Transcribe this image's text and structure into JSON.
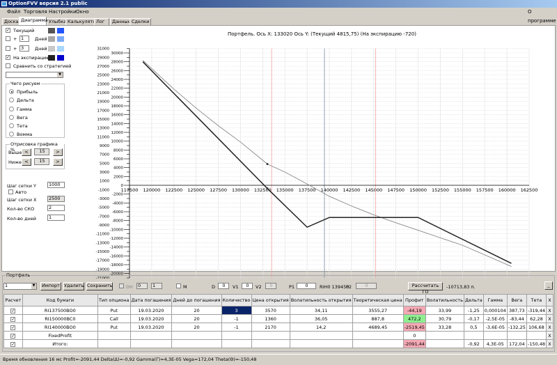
{
  "window": {
    "title": "OptionFVV версия 2.1 public"
  },
  "menu": [
    "Файл",
    "Торговля",
    "Настройки",
    "Окно"
  ],
  "menu_right": "О программе",
  "tabs": [
    "Доска",
    "Диаграмма",
    "Улыбка",
    "Калькулятор",
    "Лог",
    "Данные",
    "Сделки"
  ],
  "active_tab": "Диаграмма",
  "left": {
    "current": {
      "label": "Текущий",
      "checked": true,
      "colors": [
        "#555555",
        "#2255ff"
      ]
    },
    "plus1": {
      "prefix": "+",
      "value": "1",
      "unit": "Дней",
      "checked": false,
      "colors": [
        "#a8a8a8",
        "#7aaaf8"
      ]
    },
    "plus3": {
      "prefix": "+",
      "value": "3",
      "unit": "Дней",
      "checked": false,
      "colors": [
        "#c8c8c8",
        "#a8d8ff"
      ]
    },
    "expiry": {
      "label": "На экспирацию",
      "checked": true,
      "colors": [
        "#222222",
        "#0000cc"
      ]
    },
    "compare": {
      "label": "Сравнить со стратегией",
      "checked": false
    },
    "draw_group": {
      "title": "Чего рисуем",
      "options": [
        "Прибыль",
        "Дельта",
        "Гамма",
        "Вега",
        "Тета",
        "Вомма"
      ],
      "selected": "Прибыль"
    },
    "render_group": {
      "title": "Отрисовка графика %",
      "above_label": "Выше",
      "above_value": "15",
      "below_label": "Ниже",
      "below_value": "15",
      "dec": "<",
      "inc": ">"
    },
    "grid_y_label": "Шаг сетки Y",
    "grid_y": "1000",
    "auto_label": "Авто",
    "auto": false,
    "grid_x_label": "Шаг сетки X",
    "grid_x": "2500",
    "sko_label": "Кол-во СКО",
    "sko": "2",
    "days_label": "Кол-во дней",
    "days": "1"
  },
  "chart_title": "Портфель. Ось X:  133020 Ось Y:   (Текущий 4815,75)   (На экспирацию -720)",
  "chart_data": {
    "type": "line",
    "title": "Портфель. Ось X:  133020 Ось Y:   (Текущий 4815,75)   (На экспирацию -720)",
    "xlim": [
      117500,
      162500
    ],
    "ylim": [
      -21000,
      31000
    ],
    "x_ticks": [
      117500,
      120000,
      122500,
      125000,
      127500,
      130000,
      132500,
      135000,
      137500,
      140000,
      142500,
      145000,
      147500,
      150000,
      152500,
      155000,
      157500,
      160000,
      162500
    ],
    "y_ticks_inner": [
      30000,
      28000,
      26000,
      24000,
      22000,
      20000,
      18000,
      16000,
      14000,
      12000,
      10000,
      8000,
      6000,
      4000,
      2000,
      0,
      -2000,
      -4000,
      -6000,
      -8000,
      -10000,
      -12000,
      -14000,
      -16000,
      -18000,
      -20000
    ],
    "y_ticks_outer": [
      31000,
      29000,
      27000,
      25000,
      23000,
      21000,
      19000,
      17000,
      15000,
      13000,
      11000,
      9000,
      7000,
      5000,
      3000,
      1000,
      -1000,
      -3000,
      -5000,
      -7000,
      -9000,
      -11000,
      -13000,
      -15000,
      -17000,
      -19000,
      -21000
    ],
    "grid": true,
    "series": [
      {
        "name": "Текущий",
        "color": "#888888",
        "points": [
          [
            119000,
            28300
          ],
          [
            122500,
            21800
          ],
          [
            125000,
            17500
          ],
          [
            127500,
            13500
          ],
          [
            130000,
            9800
          ],
          [
            133020,
            4816
          ],
          [
            135000,
            3000
          ],
          [
            137500,
            300
          ],
          [
            140000,
            -2500
          ],
          [
            142500,
            -4700
          ],
          [
            145000,
            -6700
          ],
          [
            147500,
            -8500
          ],
          [
            150000,
            -10200
          ],
          [
            155000,
            -13600
          ],
          [
            160500,
            -18400
          ]
        ]
      },
      {
        "name": "На экспирацию",
        "color": "#222222",
        "points": [
          [
            119000,
            28000
          ],
          [
            133020,
            -720
          ],
          [
            137500,
            -9500
          ],
          [
            140000,
            -7300
          ],
          [
            150000,
            -7300
          ],
          [
            160500,
            -17700
          ]
        ]
      }
    ],
    "markers": [
      [
        133020,
        4816
      ],
      [
        133020,
        -720
      ]
    ],
    "vlines": [
      {
        "x": 133500,
        "color": "#f4a0a0"
      },
      {
        "x": 139450,
        "color": "#7a8aa0"
      },
      {
        "x": 145200,
        "color": "#f4a0a0"
      }
    ]
  },
  "portfolio": {
    "title": "Портфель",
    "select": "1",
    "import": "Импорт",
    "delete": "Удалить",
    "save": "Сохранить",
    "dh": "DH",
    "dh1": "0",
    "dh2": "1",
    "m": "M",
    "d_label": "D",
    "d": "0",
    "v1_label": "V1",
    "v1": "0",
    "v2_label": "V2",
    "v2": "0",
    "p1_label": "P1",
    "p1": "0",
    "instrument": "RIH0 139450",
    "p2_label": "P2",
    "p2": "0",
    "calc_go": "Рассчитать ГО",
    "go_value": "-10713,83 п.",
    "minimize": "_"
  },
  "table": {
    "headers": [
      "Расчет",
      "Код бумаги",
      "Тип опциона",
      "Дата погашения",
      "Дней до погашения",
      "Количество",
      "Цена открытия",
      "Волатильность открытия",
      "Теоретическая цена",
      "Профит",
      "Волатильность",
      "Дельта",
      "Гамма",
      "Вега",
      "Тета",
      "X"
    ],
    "rows": [
      {
        "calc": true,
        "code": "RI137500BO0",
        "type": "Put",
        "date": "19.03.2020",
        "days": "20",
        "qty": "3",
        "open": "3570",
        "open_vol": "34,11",
        "theo": "3555,27",
        "profit": "-44,19",
        "vol": "33,99",
        "delta": "-1,25",
        "gamma": "0,000104",
        "vega": "387,73",
        "theta": "-319,44",
        "x": "X"
      },
      {
        "calc": true,
        "code": "RI150000BC0",
        "type": "Call",
        "date": "19.03.2020",
        "days": "20",
        "qty": "-1",
        "open": "1360",
        "open_vol": "36,05",
        "theo": "887,8",
        "profit": "472,2",
        "vol": "30,79",
        "delta": "-0,17",
        "gamma": "-2,5E-05",
        "vega": "-83,44",
        "theta": "62,28",
        "x": "X"
      },
      {
        "calc": true,
        "code": "RI140000BO0",
        "type": "Put",
        "date": "19.03.2020",
        "days": "20",
        "qty": "-1",
        "open": "2170",
        "open_vol": "14,2",
        "theo": "4689,45",
        "profit": "-2519,45",
        "vol": "33,28",
        "delta": "0,5",
        "gamma": "-3,6E-05",
        "vega": "-132,25",
        "theta": "106,68",
        "x": "X"
      },
      {
        "calc": true,
        "code": "FixedProfit",
        "type": "",
        "date": "",
        "days": "",
        "qty": "",
        "open": "",
        "open_vol": "",
        "theo": "",
        "profit": "0",
        "vol": "",
        "delta": "",
        "gamma": "",
        "vega": "",
        "theta": "",
        "x": "X"
      },
      {
        "calc": true,
        "code": "Итого:",
        "type": "",
        "date": "",
        "days": "",
        "qty": "",
        "open": "",
        "open_vol": "",
        "theo": "",
        "profit": "-2091,44",
        "vol": "",
        "delta": "-0,92",
        "gamma": "4,3E-05",
        "vega": "172,04",
        "theta": "-150,48",
        "x": "X"
      }
    ]
  },
  "status": "Время обновления 16 мс  Profit=-2091,44 Delta(Δ)=-0,92 Gamma(Γ)=4,3E-05 Vega=172,04 Theta(Θ)=-150,48"
}
